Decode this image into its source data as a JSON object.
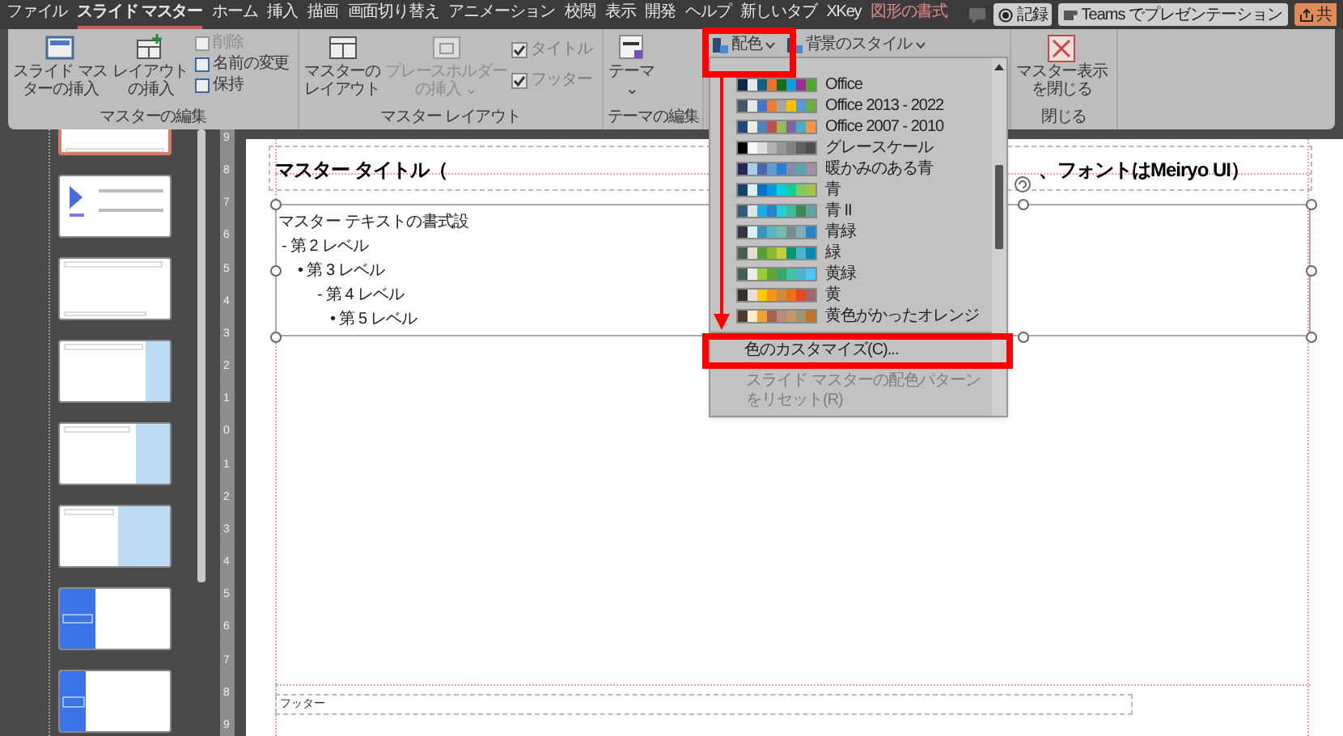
{
  "tabs": [
    {
      "label": "ファイル",
      "selected": false,
      "kind": "normal"
    },
    {
      "label": "スライド マスター",
      "selected": true,
      "kind": "normal"
    },
    {
      "label": "ホーム",
      "selected": false,
      "kind": "normal"
    },
    {
      "label": "挿入",
      "selected": false,
      "kind": "normal"
    },
    {
      "label": "描画",
      "selected": false,
      "kind": "normal"
    },
    {
      "label": "画面切り替え",
      "selected": false,
      "kind": "normal"
    },
    {
      "label": "アニメーション",
      "selected": false,
      "kind": "normal"
    },
    {
      "label": "校閲",
      "selected": false,
      "kind": "normal"
    },
    {
      "label": "表示",
      "selected": false,
      "kind": "normal"
    },
    {
      "label": "開発",
      "selected": false,
      "kind": "normal"
    },
    {
      "label": "ヘルプ",
      "selected": false,
      "kind": "normal"
    },
    {
      "label": "新しいタブ",
      "selected": false,
      "kind": "normal"
    },
    {
      "label": "XKey",
      "selected": false,
      "kind": "normal"
    },
    {
      "label": "図形の書式",
      "selected": false,
      "kind": "contextual"
    }
  ],
  "actions": [
    {
      "label": "記録",
      "kind": "record"
    },
    {
      "label": "Teams でプレゼンテーション",
      "kind": "teams"
    },
    {
      "label": "共",
      "kind": "share"
    }
  ],
  "ribbon": {
    "groups": [
      {
        "label": "マスターの編集",
        "controls": [
          {
            "kind": "large",
            "lines": [
              "スライド マス",
              "ターの挿入"
            ],
            "disabled": false
          },
          {
            "kind": "large",
            "lines": [
              "レイアウト",
              "の挿入"
            ],
            "disabled": false
          },
          {
            "kind": "stack",
            "items": [
              {
                "label": "削除",
                "disabled": true
              },
              {
                "label": "名前の変更",
                "disabled": false
              },
              {
                "label": "保持",
                "disabled": false
              }
            ]
          }
        ]
      },
      {
        "label": "マスター レイアウト",
        "controls": [
          {
            "kind": "large",
            "lines": [
              "マスターの",
              "レイアウト"
            ],
            "disabled": false
          },
          {
            "kind": "large",
            "lines": [
              "プレースホルダー",
              "の挿入 ⌄"
            ],
            "disabled": true
          },
          {
            "kind": "checks",
            "items": [
              {
                "label": "タイトル",
                "checked": true,
                "disabled": true
              },
              {
                "label": "フッター",
                "checked": true,
                "disabled": true
              }
            ]
          }
        ]
      },
      {
        "label": "テーマの編集",
        "controls": [
          {
            "kind": "large",
            "lines": [
              "テーマ",
              "⌄"
            ],
            "disabled": false
          }
        ]
      },
      {
        "controls": [
          {
            "kind": "menu",
            "label": "配色",
            "disabled": false
          },
          {
            "kind": "menu",
            "label": "背景のスタイル",
            "disabled": false
          }
        ]
      },
      {
        "label": "閉じる",
        "controls": [
          {
            "kind": "close",
            "lines": [
              "マスター表示",
              "を閉じる"
            ],
            "disabled": false
          }
        ]
      }
    ]
  },
  "color_menu": {
    "items": [
      {
        "label": "Office",
        "swatches": [
          {
            "color": "#0e2841"
          },
          {
            "color": "#e8e8e8"
          },
          {
            "color": "#156082"
          },
          {
            "color": "#e97132"
          },
          {
            "color": "#196b24"
          },
          {
            "color": "#0f9ed5"
          },
          {
            "color": "#a02b93"
          },
          {
            "color": "#4ea72e"
          }
        ]
      },
      {
        "label": "Office 2013 - 2022",
        "swatches": [
          {
            "color": "#44546a"
          },
          {
            "color": "#e7e6e6"
          },
          {
            "color": "#4472c4"
          },
          {
            "color": "#ed7d31"
          },
          {
            "color": "#a5a5a5"
          },
          {
            "color": "#ffc000"
          },
          {
            "color": "#5b9bd5"
          },
          {
            "color": "#70ad47"
          }
        ]
      },
      {
        "label": "Office 2007 - 2010",
        "swatches": [
          {
            "color": "#1f497d"
          },
          {
            "color": "#eeece1"
          },
          {
            "color": "#4f81bd"
          },
          {
            "color": "#c0504d"
          },
          {
            "color": "#9bbb59"
          },
          {
            "color": "#8064a2"
          },
          {
            "color": "#4bacc6"
          },
          {
            "color": "#f79646"
          }
        ]
      },
      {
        "label": "グレースケール",
        "swatches": [
          {
            "color": "#000000"
          },
          {
            "color": "#f8f8f8"
          },
          {
            "color": "#dddddd"
          },
          {
            "color": "#b2b2b2"
          },
          {
            "color": "#969696"
          },
          {
            "color": "#808080"
          },
          {
            "color": "#5f5f5f"
          },
          {
            "color": "#4d4d4d"
          }
        ]
      },
      {
        "label": "暖かみのある青",
        "swatches": [
          {
            "color": "#242852"
          },
          {
            "color": "#acccea"
          },
          {
            "color": "#4a66ac"
          },
          {
            "color": "#629dd1"
          },
          {
            "color": "#297fd5"
          },
          {
            "color": "#7f8fa9"
          },
          {
            "color": "#5aa2ae"
          },
          {
            "color": "#9d90a0"
          }
        ]
      },
      {
        "label": "青",
        "swatches": [
          {
            "color": "#17406d"
          },
          {
            "color": "#dbeff9"
          },
          {
            "color": "#0f6fc6"
          },
          {
            "color": "#009dd9"
          },
          {
            "color": "#0bd0d9"
          },
          {
            "color": "#10cf9b"
          },
          {
            "color": "#7cca62"
          },
          {
            "color": "#a5c249"
          }
        ]
      },
      {
        "label": "青 II",
        "swatches": [
          {
            "color": "#335b74"
          },
          {
            "color": "#dfe3e5"
          },
          {
            "color": "#1cade4"
          },
          {
            "color": "#2683c6"
          },
          {
            "color": "#27ced7"
          },
          {
            "color": "#42ba97"
          },
          {
            "color": "#3e8853"
          },
          {
            "color": "#62a39f"
          }
        ]
      },
      {
        "label": "青緑",
        "swatches": [
          {
            "color": "#373545"
          },
          {
            "color": "#dbeff9"
          },
          {
            "color": "#3494ba"
          },
          {
            "color": "#58b6c0"
          },
          {
            "color": "#75bda7"
          },
          {
            "color": "#7a8c8e"
          },
          {
            "color": "#84acb6"
          },
          {
            "color": "#2683c6"
          }
        ]
      },
      {
        "label": "緑",
        "swatches": [
          {
            "color": "#455f51"
          },
          {
            "color": "#e3ded1"
          },
          {
            "color": "#549e39"
          },
          {
            "color": "#8ab833"
          },
          {
            "color": "#c0cf3a"
          },
          {
            "color": "#029676"
          },
          {
            "color": "#4ab5c4"
          },
          {
            "color": "#0989b1"
          }
        ]
      },
      {
        "label": "黄緑",
        "swatches": [
          {
            "color": "#455f51"
          },
          {
            "color": "#ebebeb"
          },
          {
            "color": "#99cb38"
          },
          {
            "color": "#63a537"
          },
          {
            "color": "#37a76f"
          },
          {
            "color": "#44c1a3"
          },
          {
            "color": "#4eb3cf"
          },
          {
            "color": "#51c3f9"
          }
        ]
      },
      {
        "label": "黄",
        "swatches": [
          {
            "color": "#39302a"
          },
          {
            "color": "#e5dedb"
          },
          {
            "color": "#ffca08"
          },
          {
            "color": "#f8931d"
          },
          {
            "color": "#ce8d3e"
          },
          {
            "color": "#ec7016"
          },
          {
            "color": "#e64823"
          },
          {
            "color": "#9c6a6a"
          }
        ]
      },
      {
        "label": "黄色がかったオレンジ",
        "swatches": [
          {
            "color": "#4e3b30"
          },
          {
            "color": "#fbeec9"
          },
          {
            "color": "#f0a22e"
          },
          {
            "color": "#a5644e"
          },
          {
            "color": "#b58b80"
          },
          {
            "color": "#c3986d"
          },
          {
            "color": "#a19574"
          },
          {
            "color": "#c17529"
          }
        ]
      }
    ],
    "custom": {
      "label": "色のカスタマイズ(C)..."
    },
    "reset": {
      "label": "スライド マスターの配色パターンをリセット(R)",
      "disabled": true
    }
  },
  "thumbnails": [
    {
      "kind": "blank",
      "selected": true
    },
    {
      "kind": "logo",
      "selected": false
    },
    {
      "kind": "plain",
      "selected": false
    },
    {
      "kind": "light-narrow",
      "selected": false
    },
    {
      "kind": "light-medium",
      "selected": false
    },
    {
      "kind": "light-wide",
      "selected": false
    },
    {
      "kind": "blue-wide",
      "selected": false
    },
    {
      "kind": "blue-narrow",
      "selected": false
    }
  ],
  "ruler": [
    "9",
    "8",
    "7",
    "6",
    "5",
    "4",
    "3",
    "2",
    "1",
    "0",
    "1",
    "2",
    "3",
    "4",
    "5",
    "6",
    "7",
    "8",
    "9"
  ],
  "slide": {
    "title_parts": [
      "マスター タイトル（",
      "、フォントはMeiryo UI）"
    ],
    "body": [
      {
        "text": "マスター テキストの書式設",
        "children": [
          {
            "text": "- 第 2 レベル",
            "children": [
              {
                "text": "• 第 3 レベル",
                "children": [
                  {
                    "text": "- 第 4 レベル",
                    "children": [
                      {
                        "text": "• 第 5 レベル"
                      }
                    ]
                  }
                ]
              }
            ]
          }
        ]
      }
    ],
    "footer": "フッター"
  }
}
